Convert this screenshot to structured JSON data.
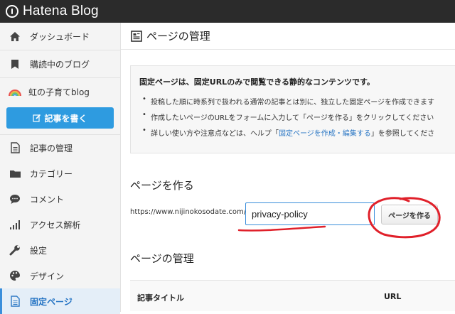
{
  "app": {
    "logo_text": "Hatena Blog"
  },
  "sidebar": {
    "items": [
      {
        "label": "ダッシュボード",
        "icon": "home-icon"
      },
      {
        "label": "購読中のブログ",
        "icon": "bookmark-icon"
      }
    ],
    "blog": {
      "label": "虹の子育てblog",
      "icon": "rainbow-icon"
    },
    "write_button": "記事を書く",
    "menu": [
      {
        "label": "記事の管理",
        "icon": "document-icon"
      },
      {
        "label": "カテゴリー",
        "icon": "folder-icon"
      },
      {
        "label": "コメント",
        "icon": "comment-icon"
      },
      {
        "label": "アクセス解析",
        "icon": "bar-chart-icon"
      },
      {
        "label": "設定",
        "icon": "wrench-icon"
      },
      {
        "label": "デザイン",
        "icon": "palette-icon"
      },
      {
        "label": "固定ページ",
        "icon": "page-icon"
      }
    ]
  },
  "main": {
    "page_title": "ページの管理",
    "info": {
      "title": "固定ページは、固定URLのみで閲覧できる静的なコンテンツです。",
      "line1": "投稿した順に時系列で扱われる通常の記事とは別に、独立した固定ページを作成できます",
      "line2": "作成したいページのURLをフォームに入力して「ページを作る」をクリックしてください",
      "line3_before": "詳しい使い方や注意点などは、ヘルプ「",
      "line3_link": "固定ページを作成・編集する",
      "line3_after": "」を参照してくださ"
    },
    "create": {
      "title": "ページを作る",
      "url_prefix": "https://www.nijinokosodate.com/",
      "slug_value": "privacy-policy",
      "button_label": "ページを作る"
    },
    "manage": {
      "title": "ページの管理",
      "columns": [
        "記事タイトル",
        "URL"
      ]
    }
  },
  "colors": {
    "accent": "#2e9be0",
    "link": "#2e79c5",
    "annotation": "#e0202a"
  }
}
